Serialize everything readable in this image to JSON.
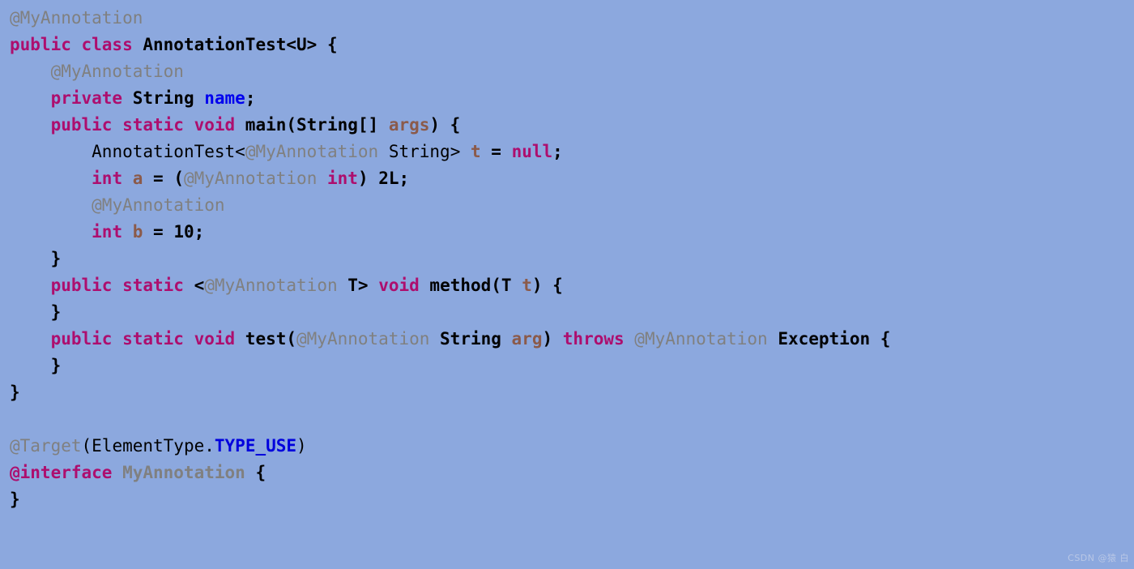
{
  "editor": {
    "language": "java",
    "background_color": "#8ca8de",
    "font_size_px": 21,
    "line_height_px": 33,
    "line_count": 18
  },
  "theme": {
    "keyword_color": "#ad0e6e",
    "annotation_color": "#808080",
    "type_color": "#000000",
    "field_color": "#0000ee",
    "variable_color": "#8b5a4a",
    "constant_color": "#0000dd",
    "number_color": "#000000",
    "punctuation_color": "#000000"
  },
  "watermark": {
    "text": "CSDN @猿 白"
  },
  "code": {
    "plain_text": "@MyAnnotation\npublic class AnnotationTest<U> {\n    @MyAnnotation\n    private String name;\n    public static void main(String[] args) {\n        AnnotationTest<@MyAnnotation String> t = null;\n        int a = (@MyAnnotation int) 2L;\n        @MyAnnotation\n        int b = 10;\n    }\n    public static <@MyAnnotation T> void method(T t) {\n    }\n    public static void test(@MyAnnotation String arg) throws @MyAnnotation Exception {\n    }\n}\n\n@Target(ElementType.TYPE_USE)\n@interface MyAnnotation {\n}",
    "lines": [
      {
        "n": 1,
        "text": "@MyAnnotation"
      },
      {
        "n": 2,
        "text": "public class AnnotationTest<U> {"
      },
      {
        "n": 3,
        "text": "    @MyAnnotation"
      },
      {
        "n": 4,
        "text": "    private String name;"
      },
      {
        "n": 5,
        "text": "    public static void main(String[] args) {"
      },
      {
        "n": 6,
        "text": "        AnnotationTest<@MyAnnotation String> t = null;"
      },
      {
        "n": 7,
        "text": "        int a = (@MyAnnotation int) 2L;"
      },
      {
        "n": 8,
        "text": "        @MyAnnotation"
      },
      {
        "n": 9,
        "text": "        int b = 10;"
      },
      {
        "n": 10,
        "text": "    }"
      },
      {
        "n": 11,
        "text": "    public static <@MyAnnotation T> void method(T t) {"
      },
      {
        "n": 12,
        "text": "    }"
      },
      {
        "n": 13,
        "text": "    public static void test(@MyAnnotation String arg) throws @MyAnnotation Exception {"
      },
      {
        "n": 14,
        "text": "    }"
      },
      {
        "n": 15,
        "text": "}"
      },
      {
        "n": 16,
        "text": ""
      },
      {
        "n": 17,
        "text": "@Target(ElementType.TYPE_USE)"
      },
      {
        "n": 18,
        "text": "@interface MyAnnotation {"
      },
      {
        "n": 19,
        "text": "}"
      }
    ],
    "tokens": {
      "l1": {
        "ann": "@MyAnnotation"
      },
      "l2": {
        "kw1": "public class ",
        "type": "AnnotationTest<U>",
        "sp": " ",
        "brace": "{"
      },
      "l3": {
        "indent": "    ",
        "ann": "@MyAnnotation"
      },
      "l4": {
        "indent": "    ",
        "kw": "private ",
        "type": "String ",
        "field": "name",
        "semi": ";"
      },
      "l5": {
        "indent": "    ",
        "kw": "public static void ",
        "type": "main(String[] ",
        "var": "args",
        "tail": ") {"
      },
      "l6": {
        "indent": "        ",
        "plain": "AnnotationTest<",
        "ann": "@MyAnnotation",
        "plain2": " String> ",
        "var": "t",
        "eq": " = ",
        "kw": "null",
        "semi": ";"
      },
      "l7": {
        "indent": "        ",
        "kw": "int ",
        "var": "a",
        "eq": " = ",
        "paren": "(",
        "ann": "@MyAnnotation ",
        "kw2": "int",
        "paren2": ") ",
        "num": "2L;"
      },
      "l8": {
        "indent": "        ",
        "ann": "@MyAnnotation"
      },
      "l9": {
        "indent": "        ",
        "kw": "int ",
        "var": "b",
        "eq": " = ",
        "num": "10;"
      },
      "l10": {
        "indent": "    ",
        "brace": "}"
      },
      "l11": {
        "indent": "    ",
        "kw": "public static ",
        "lt": "<",
        "ann": "@MyAnnotation ",
        "type": "T> ",
        "kw2": "void ",
        "type2": "method(T ",
        "var": "t",
        "tail": ") {"
      },
      "l12": {
        "indent": "    ",
        "brace": "}"
      },
      "l13": {
        "indent": "    ",
        "kw": "public static void ",
        "type": "test(",
        "ann": "@MyAnnotation ",
        "type2": "String ",
        "var": "arg",
        "paren": ") ",
        "kw2": "throws ",
        "ann2": "@MyAnnotation ",
        "type3": "Exception ",
        "brace": "{"
      },
      "l14": {
        "indent": "    ",
        "brace": "}"
      },
      "l15": {
        "brace": "}"
      },
      "l16": {
        "blank": " "
      },
      "l17": {
        "ann": "@Target",
        "plain": "(ElementType.",
        "const": "TYPE_USE",
        "plain2": ")"
      },
      "l18": {
        "kw": "@interface ",
        "ann": "MyAnnotation ",
        "brace": "{"
      },
      "l19": {
        "brace": "}"
      }
    }
  }
}
